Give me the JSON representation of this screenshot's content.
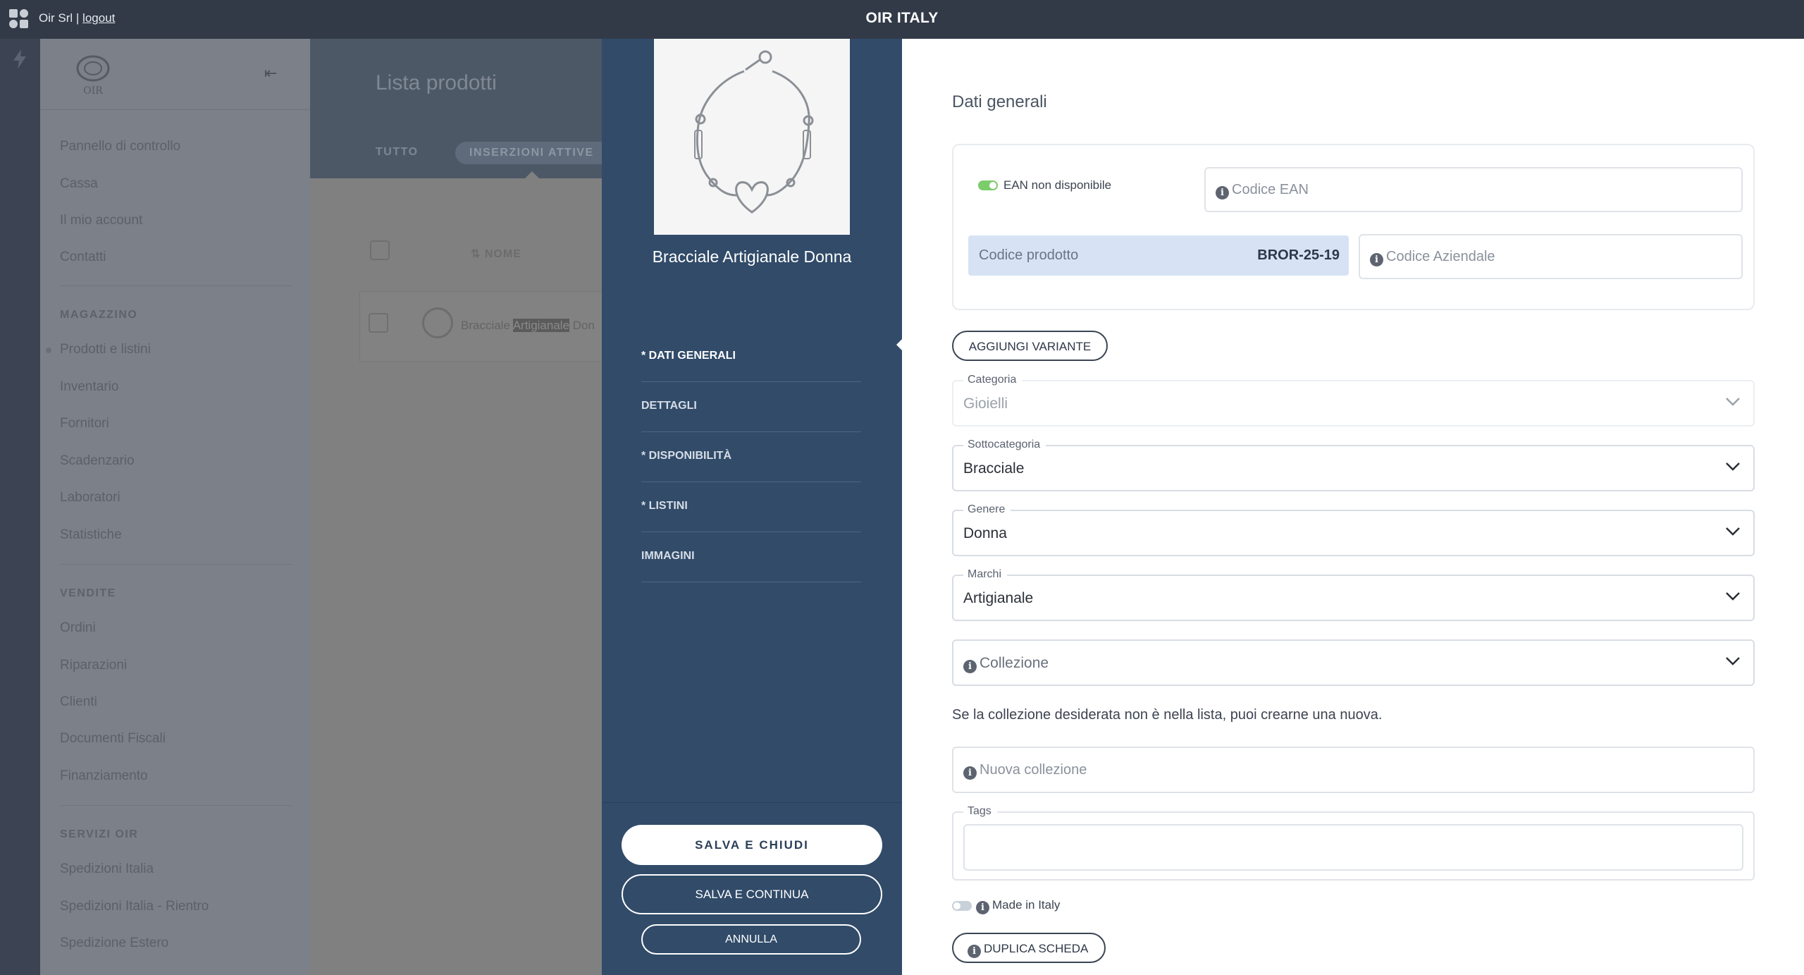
{
  "topbar": {
    "company": "Oir Srl |",
    "logout": "logout",
    "brand": "OIR ITALY"
  },
  "sidebar": {
    "logo_text": "OIR",
    "items_top": [
      "Pannello di controllo",
      "Cassa",
      "Il mio account",
      "Contatti"
    ],
    "section_magazzino": "MAGAZZINO",
    "items_magazzino": [
      "Prodotti e listini",
      "Inventario",
      "Fornitori",
      "Scadenzario",
      "Laboratori",
      "Statistiche"
    ],
    "section_vendite": "VENDITE",
    "items_vendite": [
      "Ordini",
      "Riparazioni",
      "Clienti",
      "Documenti Fiscali",
      "Finanziamento"
    ],
    "section_servizi": "SERVIZI OIR",
    "items_servizi": [
      "Spedizioni Italia",
      "Spedizioni Italia - Rientro",
      "Spedizione Estero"
    ]
  },
  "list": {
    "title": "Lista prodotti",
    "tab_all": "TUTTO",
    "tab_active": "INSERZIONI ATTIVE",
    "col_name": "NOME",
    "row_prefix": "Bracciale ",
    "row_highlight": "Artigianale",
    "row_suffix": " Don"
  },
  "panel": {
    "product_name": "Bracciale Artigianale Donna",
    "nav": [
      "* DATI GENERALI",
      "DETTAGLI",
      "* DISPONIBILITÀ",
      "* LISTINI",
      "IMMAGINI"
    ],
    "save_close": "SALVA E CHIUDI",
    "save_continue": "SALVA E CONTINUA",
    "cancel": "ANNULLA"
  },
  "form": {
    "section_title": "Dati generali",
    "ean_toggle_label": "EAN non disponibile",
    "ean_placeholder": "Codice EAN",
    "product_code_label": "Codice prodotto",
    "product_code_value": "BROR-25-19",
    "company_code_placeholder": "Codice Aziendale",
    "add_variant": "AGGIUNGI VARIANTE",
    "categoria_label": "Categoria",
    "categoria_value": "Gioielli",
    "sottocategoria_label": "Sottocategoria",
    "sottocategoria_value": "Bracciale",
    "genere_label": "Genere",
    "genere_value": "Donna",
    "marchi_label": "Marchi",
    "marchi_value": "Artigianale",
    "collezione_placeholder": "Collezione",
    "collection_hint": "Se la collezione desiderata non è nella lista, puoi crearne una nuova.",
    "new_collection_placeholder": "Nuova collezione",
    "tags_label": "Tags",
    "made_in_italy": "Made in Italy",
    "duplicate": "DUPLICA SCHEDA"
  },
  "colors": {
    "topbar": "#323a48",
    "panel": "#314b69",
    "toggle_on": "#7ccc6a",
    "code_bg": "#d7e3f4"
  },
  "icons": [
    "app-logo-icon",
    "bolt-icon",
    "collapse-icon",
    "info-icon",
    "chevron-down-icon",
    "sort-icon"
  ]
}
